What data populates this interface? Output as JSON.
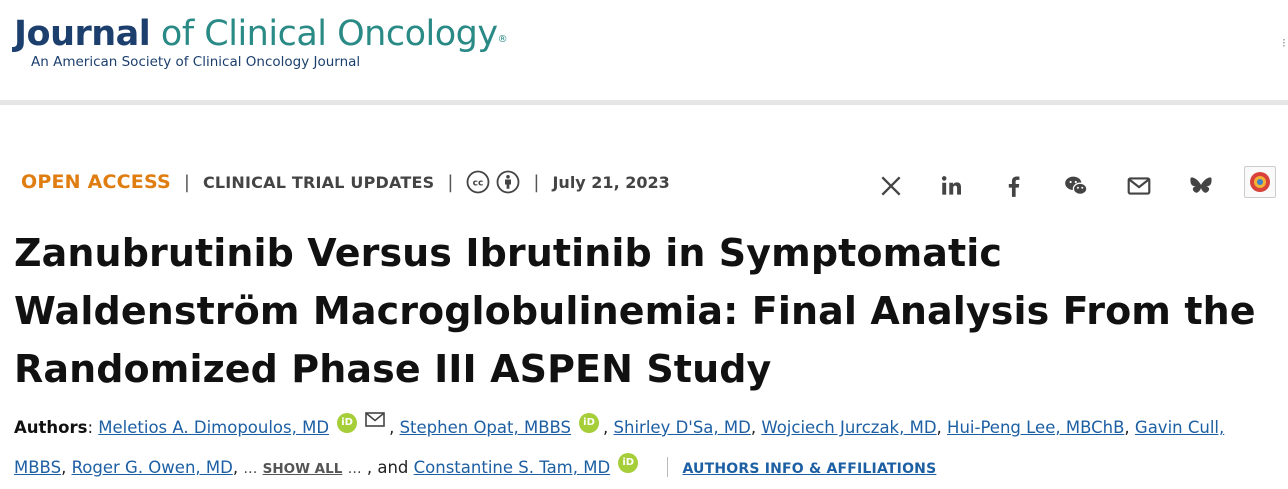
{
  "journal": {
    "name_primary": "Journal",
    "name_secondary": "of Clinical Oncology",
    "registered": "®",
    "tagline": "An American Society of Clinical Oncology Journal"
  },
  "article_meta": {
    "access": "OPEN ACCESS",
    "separator": "|",
    "category": "CLINICAL TRIAL UPDATES",
    "license_icons": [
      "creative-commons-icon",
      "attribution-icon"
    ],
    "date": "July 21, 2023"
  },
  "share_icons": [
    "x-icon",
    "linkedin-icon",
    "facebook-icon",
    "wechat-icon",
    "email-icon",
    "bluesky-icon",
    "altmetric-icon"
  ],
  "title": "Zanubrutinib Versus Ibrutinib in Symptomatic Waldenström Macroglobulinemia: Final Analysis From the Randomized Phase III ASPEN Study",
  "authors": {
    "label": "Authors",
    "colon": ":",
    "list": [
      "Meletios A. Dimopoulos, MD",
      "Stephen Opat, MBBS",
      "Shirley D'Sa, MD",
      "Wojciech Jurczak, MD",
      "Hui-Peng Lee, MBChB",
      "Gavin Cull, MBBS",
      "Roger G. Owen, MD",
      "Constantine S. Tam, MD"
    ],
    "orcid_label": "iD",
    "show_all": "SHOW ALL",
    "ellipsis": "…",
    "and_text": "and",
    "affiliations_link": "AUTHORS INFO & AFFILIATIONS"
  },
  "colors": {
    "logo_dark": "#1c3f6e",
    "logo_teal": "#2a8a86",
    "open_access": "#e07d10",
    "link": "#1d5fa3",
    "orcid": "#a6ce39"
  }
}
